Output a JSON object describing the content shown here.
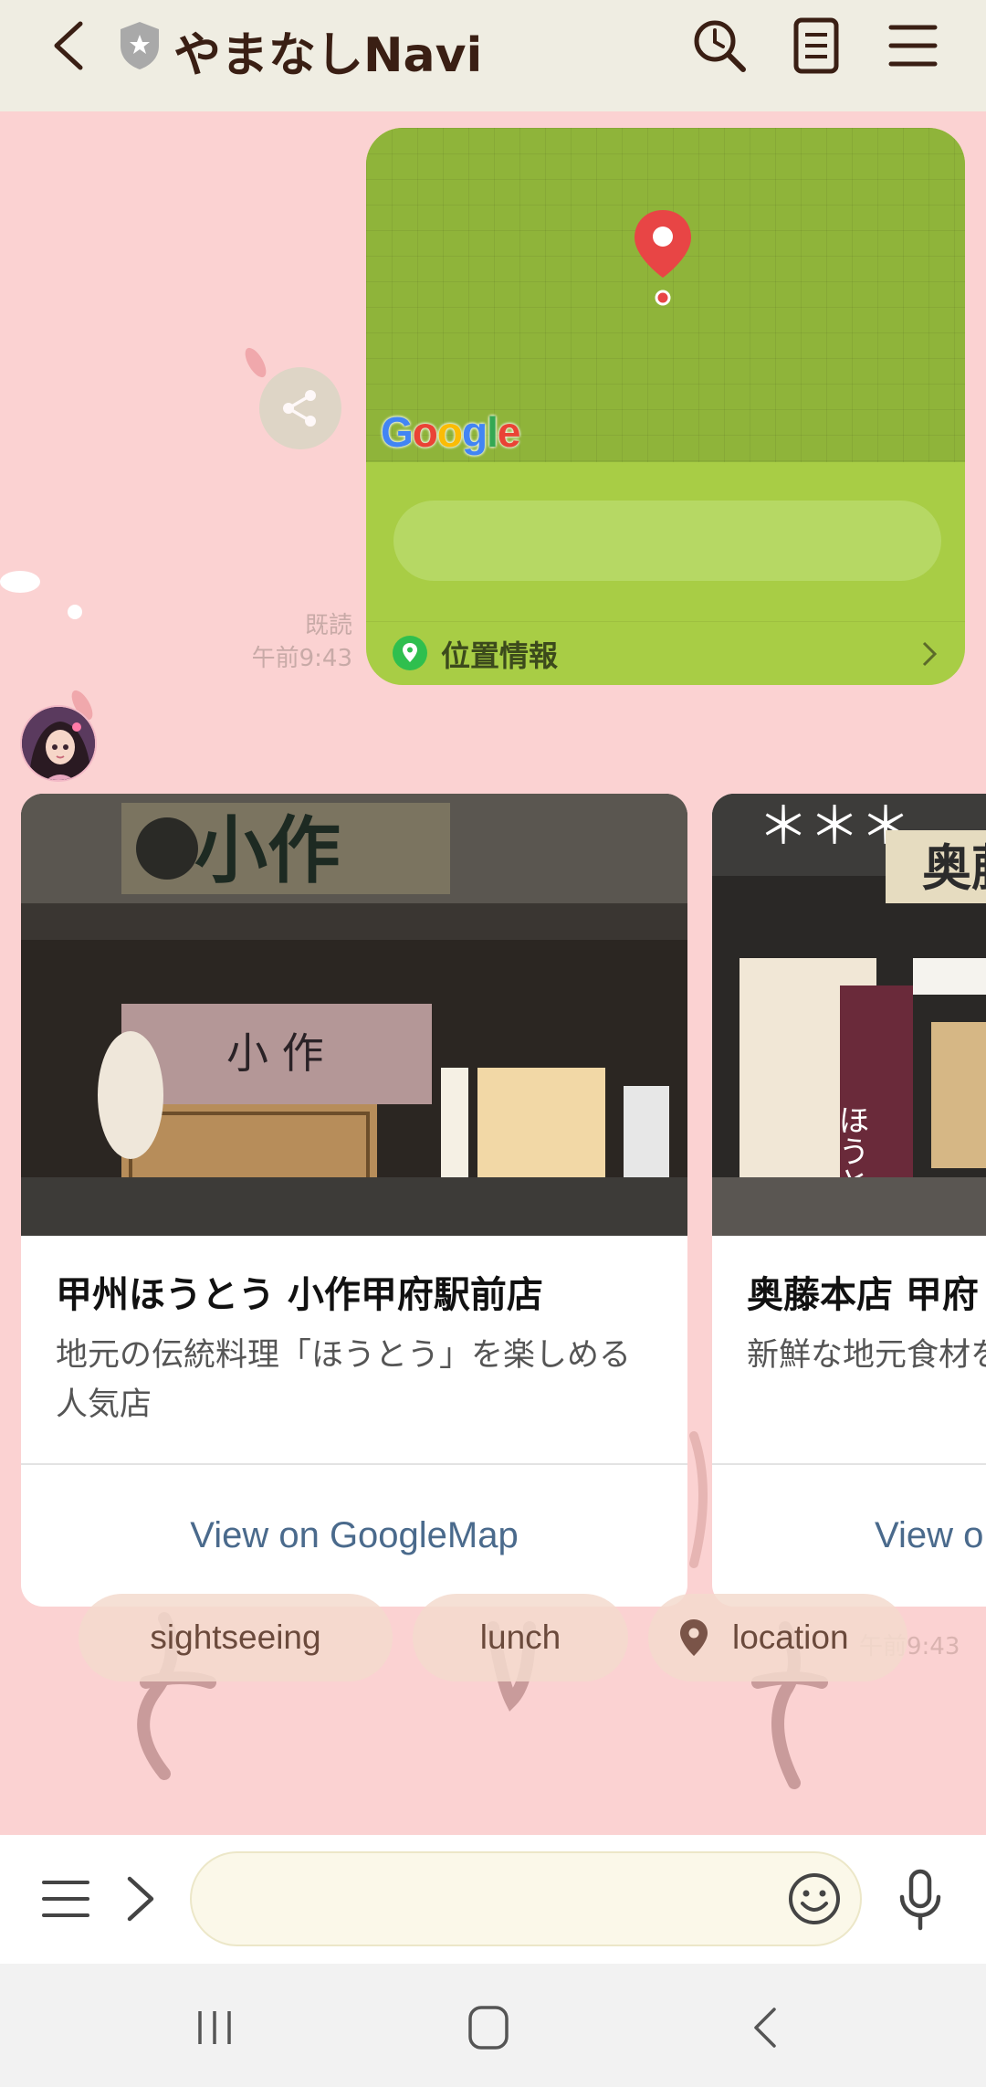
{
  "header": {
    "title": "やまなしNavi",
    "back_icon": "chevron-left-icon",
    "shield_icon": "shield-icon",
    "search_icon": "history-search-icon",
    "notes_icon": "notes-icon",
    "menu_icon": "hamburger-icon"
  },
  "map_message": {
    "logo": "Google",
    "location_label": "位置情報",
    "read_status": "既読",
    "time": "午前9:43"
  },
  "cards": [
    {
      "title": "甲州ほうとう 小作甲府駅前店",
      "description": "地元の伝統料理「ほうとう」を楽しめる人気店",
      "link": "View on GoogleMap"
    },
    {
      "title": "奥藤本店 甲府",
      "description": "新鮮な地元食材を JSON:event: pin",
      "link": "View o"
    }
  ],
  "received_time": "午前9:43",
  "quick_replies": {
    "sightseeing": "sightseeing",
    "lunch": "lunch",
    "location": "location"
  },
  "input": {
    "placeholder": "",
    "value": ""
  },
  "colors": {
    "chat_background": "#fbd2d2",
    "header_background": "#efede2",
    "map_card": "#a8cd45",
    "link_text": "#4a6a8c"
  }
}
